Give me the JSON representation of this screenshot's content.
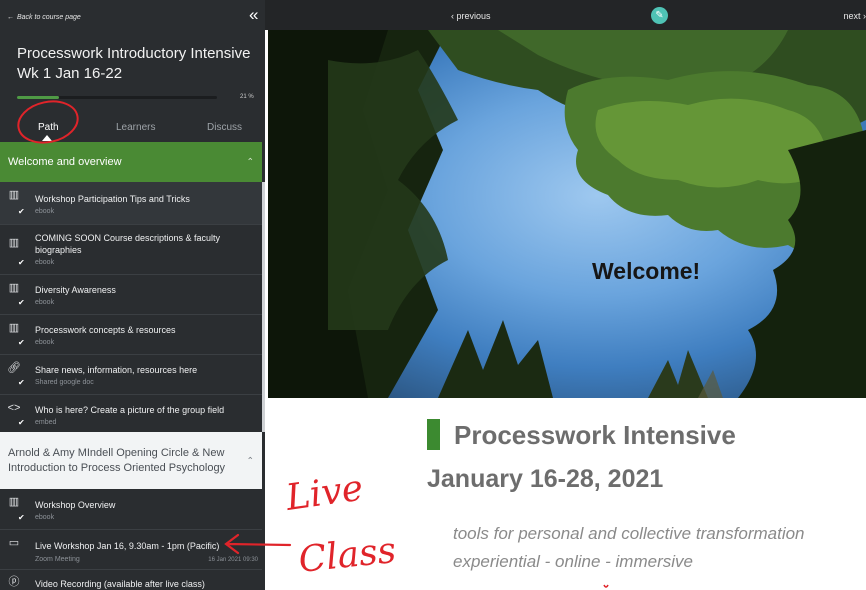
{
  "sidebar": {
    "back_link": "Back to course page",
    "collapse_icon": "double-chevron-left-icon",
    "course_title": "Processwork Introductory Intensive Wk 1 Jan 16-22",
    "progress_percent": 21,
    "progress_label": "21 %",
    "tabs": [
      {
        "label": "Path",
        "active": true
      },
      {
        "label": "Learners",
        "active": false
      },
      {
        "label": "Discuss",
        "active": false
      }
    ],
    "sections": [
      {
        "title": "Welcome and overview",
        "items": [
          {
            "title": "Workshop Participation Tips and Tricks",
            "type": "ebook",
            "icon": "book-icon",
            "done": true
          },
          {
            "title": "COMING SOON Course descriptions & faculty biographies",
            "type": "ebook",
            "icon": "book-icon",
            "done": true
          },
          {
            "title": "Diversity Awareness",
            "type": "ebook",
            "icon": "book-icon",
            "done": true
          },
          {
            "title": "Processwork concepts & resources",
            "type": "ebook",
            "icon": "book-icon",
            "done": true
          },
          {
            "title": "Share news, information, resources here",
            "type": "Shared google doc",
            "icon": "link-icon",
            "done": true
          },
          {
            "title": "Who is here? Create a picture of the group field",
            "type": "embed",
            "icon": "code-icon",
            "done": true
          }
        ]
      },
      {
        "title": "Arnold & Amy MIndell Opening Circle & New Introduction to Process Oriented Psychology",
        "items": [
          {
            "title": "Workshop Overview",
            "type": "ebook",
            "icon": "book-icon",
            "done": true
          },
          {
            "title": "Live Workshop Jan 16, 9.30am - 1pm (Pacific)",
            "type": "Zoom Meeting",
            "icon": "video-icon",
            "done": false,
            "date": "16 Jan 2021 09:30"
          },
          {
            "title": "Video Recording (available after live class)",
            "type": "",
            "icon": "play-circle-icon",
            "done": false
          }
        ]
      }
    ]
  },
  "topbar": {
    "previous": "‹ previous",
    "next": "next ›",
    "edit_icon": "pencil-icon"
  },
  "content": {
    "hero_text": "Welcome!",
    "heading": "Processwork Intensive",
    "dates": "January 16-28, 2021",
    "tagline_1": "tools for personal and collective transformation",
    "tagline_2": "experiential -  online - immersive"
  },
  "annotation": {
    "text_line_1": "Live",
    "text_line_2": "Class",
    "color": "#e0242a"
  },
  "colors": {
    "sidebar_bg": "#2a2d30",
    "active_section": "#4a8a34",
    "accent_green": "#3c8a30",
    "edit_button": "#4fc3b5"
  }
}
